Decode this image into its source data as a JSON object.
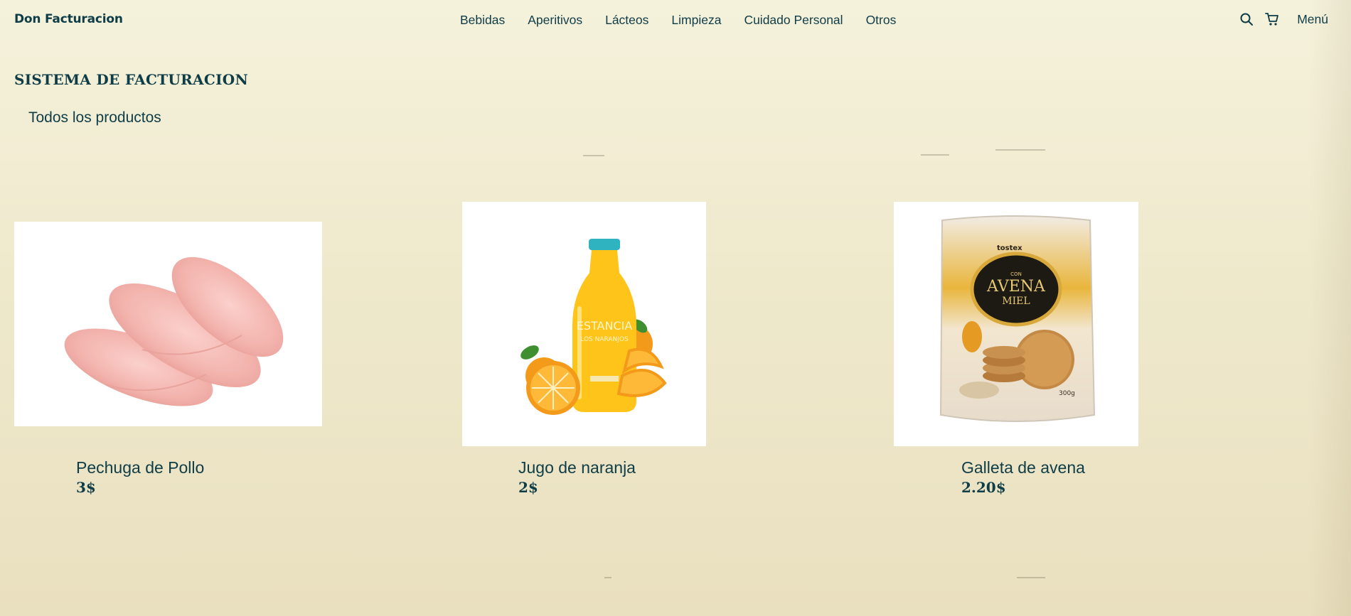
{
  "header": {
    "brand": "Don Facturacion",
    "nav": [
      "Bebidas",
      "Aperitivos",
      "Lácteos",
      "Limpieza",
      "Cuidado Personal",
      "Otros"
    ],
    "icons": [
      "search-icon",
      "cart-icon"
    ],
    "menu_label": "Menú"
  },
  "page_title": "SISTEMA DE FACTURACION",
  "section_title": "Todos los productos",
  "products": [
    {
      "name": "Pechuga de Pollo",
      "price": "3$",
      "image": "chicken-breast-image"
    },
    {
      "name": "Jugo de naranja",
      "price": "2$",
      "image": "orange-juice-bottle-image"
    },
    {
      "name": "Galleta de avena",
      "price": "2.20$",
      "image": "oat-cookie-package-image",
      "package_text": {
        "brand": "tostex",
        "con": "CON",
        "main": "AVENA",
        "sub": "MIEL",
        "weight": "300g"
      }
    }
  ],
  "colors": {
    "text": "#0f3d47",
    "background_top": "#f5f2dc",
    "background_bottom": "#e9e0bf"
  }
}
